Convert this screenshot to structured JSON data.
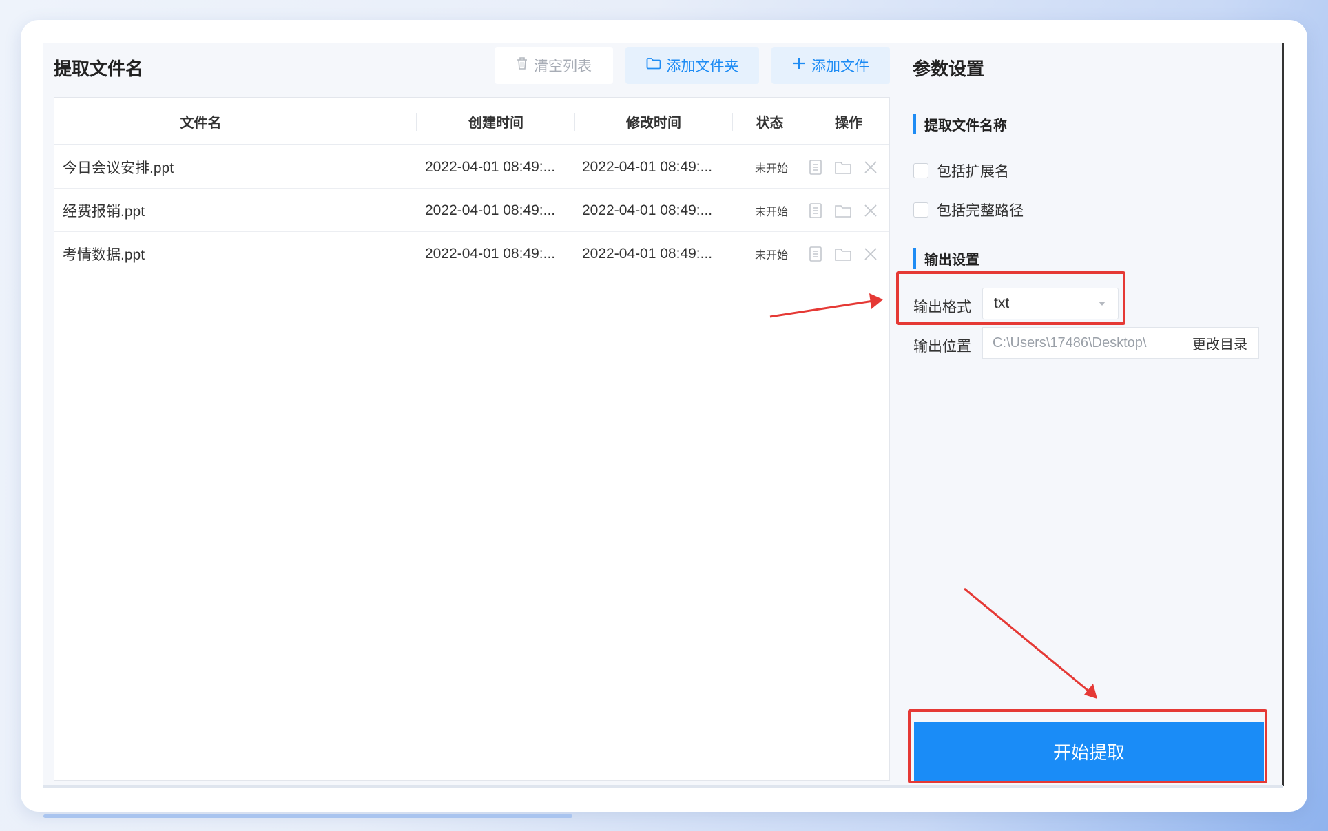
{
  "left_panel": {
    "title": "提取文件名",
    "toolbar": {
      "clear_label": "清空列表",
      "add_folder_label": "添加文件夹",
      "add_file_label": "添加文件"
    },
    "table": {
      "headers": [
        "文件名",
        "创建时间",
        "修改时间",
        "状态",
        "操作"
      ],
      "rows": [
        {
          "name": "今日会议安排.ppt",
          "created": "2022-04-01 08:49:...",
          "modified": "2022-04-01 08:49:...",
          "status": "未开始"
        },
        {
          "name": "经费报销.ppt",
          "created": "2022-04-01 08:49:...",
          "modified": "2022-04-01 08:49:...",
          "status": "未开始"
        },
        {
          "name": "考情数据.ppt",
          "created": "2022-04-01 08:49:...",
          "modified": "2022-04-01 08:49:...",
          "status": "未开始"
        }
      ],
      "row_action_icons": [
        "document-icon",
        "folder-icon",
        "close-icon"
      ]
    }
  },
  "settings": {
    "title": "参数设置",
    "extract_section": {
      "heading": "提取文件名称",
      "options": [
        {
          "label": "包括扩展名",
          "checked": false
        },
        {
          "label": "包括完整路径",
          "checked": false
        }
      ]
    },
    "output_section": {
      "heading": "输出设置",
      "format_label": "输出格式",
      "format_value": "txt",
      "location_label": "输出位置",
      "location_value": "C:\\Users\\17486\\Desktop\\",
      "change_dir_label": "更改目录"
    },
    "start_label": "开始提取"
  },
  "colors": {
    "accent": "#1e8cf4",
    "start_button": "#1a8cf7",
    "highlight": "#e53935",
    "light_button_bg": "#e6f1fd"
  }
}
